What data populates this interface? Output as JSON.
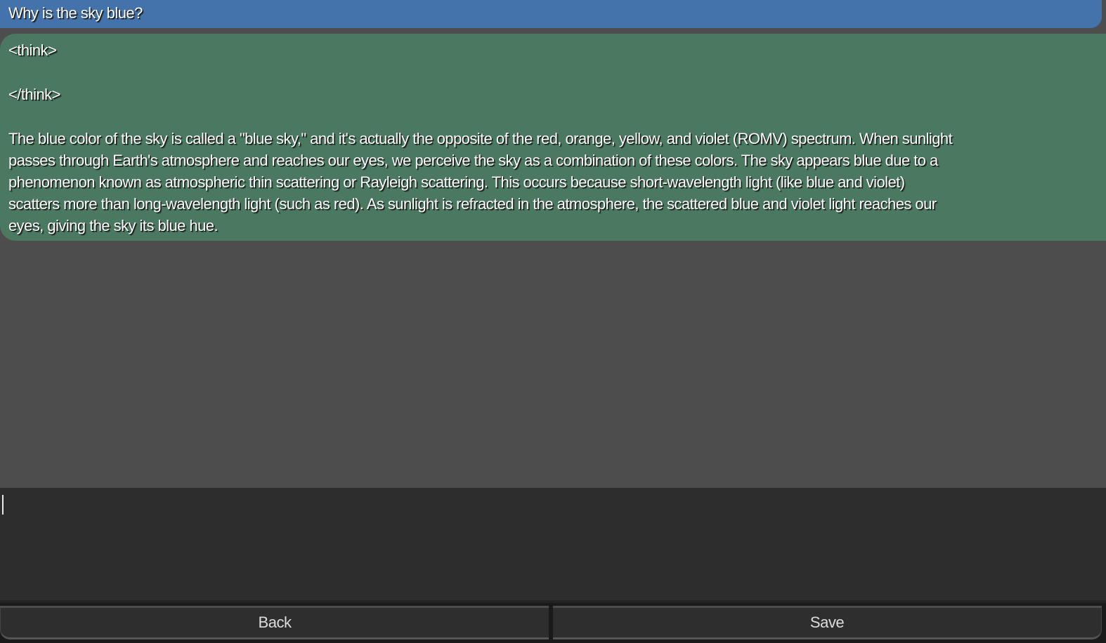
{
  "chat": {
    "user_message": "Why is the sky blue?",
    "assistant_message": {
      "think_open": "<think>",
      "think_close": "</think>",
      "lines": [
        "The blue color of the sky is called a \"blue sky,\" and it's actually the opposite of the red, orange, yellow, and violet (ROMV) spectrum. When sunlight",
        "passes through Earth's atmosphere and reaches our eyes, we perceive the sky as a combination of these colors. The sky appears blue due to a",
        "phenomenon known as atmospheric thin scattering or Rayleigh scattering. This occurs because short-wavelength light (like blue and violet)",
        "scatters more than long-wavelength light (such as red). As sunlight is refracted in the atmosphere, the scattered blue and violet light reaches our",
        "eyes, giving the sky its blue hue."
      ]
    }
  },
  "input": {
    "value": ""
  },
  "buttons": {
    "back": "Back",
    "save": "Save"
  },
  "colors": {
    "user_bubble": "#4472aa",
    "assistant_bubble": "#4a7860",
    "background": "#4d4d4d",
    "input": "#2d2d2d"
  }
}
